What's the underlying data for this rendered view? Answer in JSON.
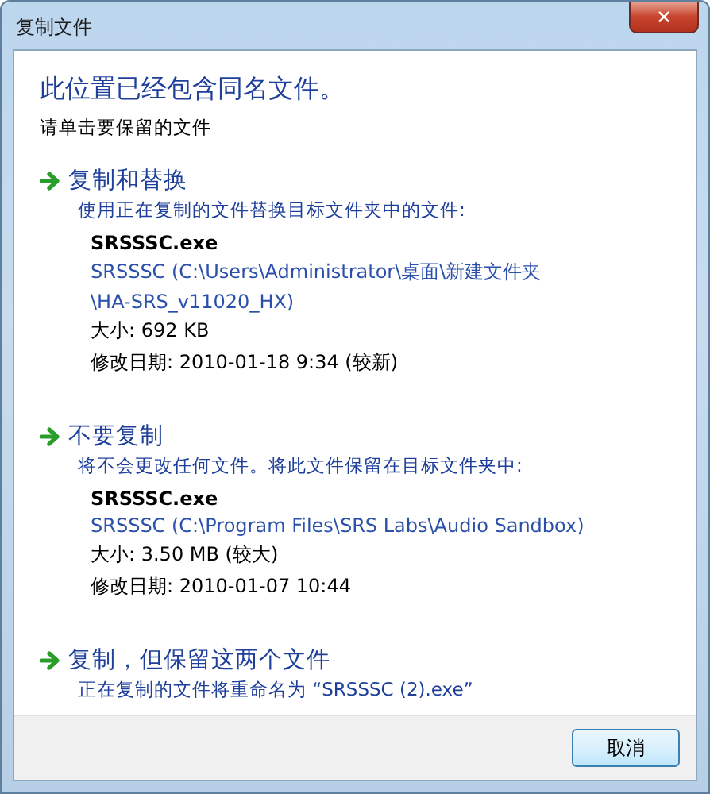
{
  "window": {
    "title": "复制文件",
    "close": "✕"
  },
  "heading": "此位置已经包含同名文件。",
  "instruction": "请单击要保留的文件",
  "options": [
    {
      "title": "复制和替换",
      "description": "使用正在复制的文件替换目标文件夹中的文件:",
      "file": {
        "name": "SRSSSC.exe",
        "path_lines": [
          "SRSSSC (C:\\Users\\Administrator\\桌面\\新建文件夹",
          "\\HA-SRS_v11020_HX)"
        ],
        "size": "大小: 692 KB",
        "modified": "修改日期: 2010-01-18  9:34 (较新)"
      }
    },
    {
      "title": "不要复制",
      "description": "将不会更改任何文件。将此文件保留在目标文件夹中:",
      "file": {
        "name": "SRSSSC.exe",
        "path_lines": [
          "SRSSSC (C:\\Program Files\\SRS Labs\\Audio Sandbox)"
        ],
        "size": "大小: 3.50 MB (较大)",
        "modified": "修改日期: 2010-01-07  10:44"
      }
    },
    {
      "title": "复制，但保留这两个文件",
      "description": "正在复制的文件将重命名为 “SRSSSC (2).exe”"
    }
  ],
  "buttons": [
    "取消"
  ]
}
